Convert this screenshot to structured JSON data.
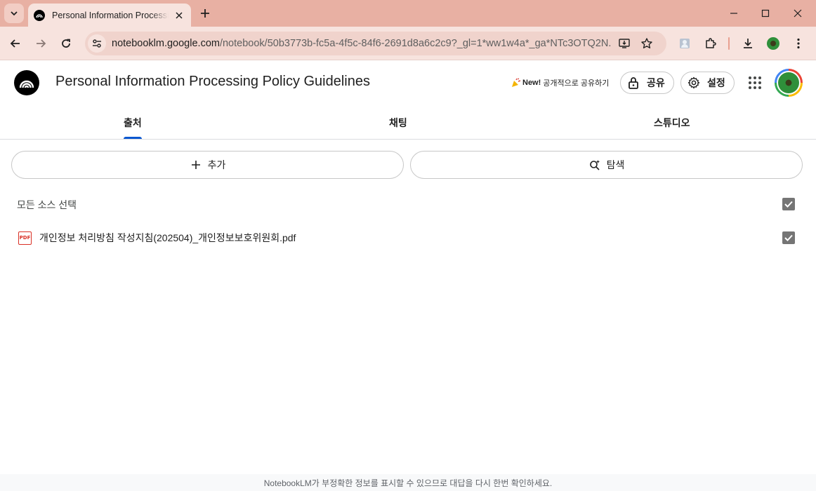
{
  "browser": {
    "tab_title": "Personal Information Processing Policy Guidelines",
    "url_host": "notebooklm.google.com",
    "url_path": "/notebook/50b3773b-fc5a-4f5c-84f6-2691d8a6c2c9?_gl=1*ww1w4a*_ga*NTc3OTQ2N..."
  },
  "header": {
    "title": "Personal Information Processing Policy Guidelines",
    "promo_new": "New!",
    "promo_text": "공개적으로 공유하기",
    "share_label": "공유",
    "settings_label": "설정"
  },
  "tabs": [
    {
      "label": "출처",
      "active": true
    },
    {
      "label": "채팅",
      "active": false
    },
    {
      "label": "스튜디오",
      "active": false
    }
  ],
  "sources": {
    "add_label": "추가",
    "discover_label": "탐색",
    "select_all_label": "모든 소스 선택",
    "items": [
      {
        "name": "개인정보 처리방침 작성지침(202504)_개인정보보호위원회.pdf",
        "type": "pdf",
        "type_label": "PDF",
        "checked": true
      }
    ]
  },
  "footer": {
    "disclaimer": "NotebookLM가 부정확한 정보를 표시할 수 있으므로 대답을 다시 한번 확인하세요."
  },
  "colors": {
    "titlebar": "#e8b0a3",
    "toolbar": "#f7e3de",
    "accent": "#0b57d0",
    "pdf": "#d93025"
  }
}
